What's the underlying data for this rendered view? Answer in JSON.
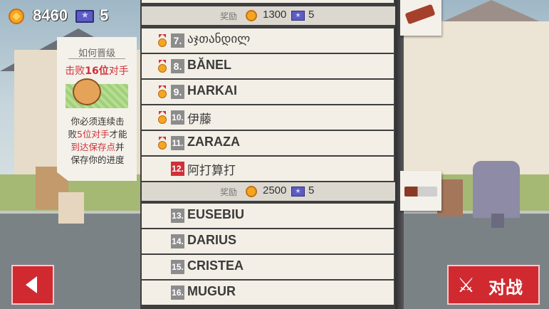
{
  "hud": {
    "coins": "8460",
    "stars": "5"
  },
  "tip": {
    "title": "如何晋级",
    "goal_pre": "击败",
    "goal_num": "16位",
    "goal_post": "对手",
    "body_1": "你必须连续击",
    "body_2a": "败",
    "body_2b": "5位对手",
    "body_2c": "才能",
    "body_3": "到达保存点",
    "body_3b": "并",
    "body_4": "保存你的进度"
  },
  "rewards": [
    {
      "label": "奖励",
      "coins": "1300",
      "stars": "5"
    },
    {
      "label": "奖励",
      "coins": "2500",
      "stars": "5"
    }
  ],
  "players": [
    {
      "rank": "7.",
      "name": "აჯთანდილ",
      "medal": true
    },
    {
      "rank": "8.",
      "name": "BĂNEL",
      "medal": true
    },
    {
      "rank": "9.",
      "name": "HARKAI",
      "medal": true
    },
    {
      "rank": "10.",
      "name": "伊藤",
      "medal": true
    },
    {
      "rank": "11.",
      "name": "ZARAZA",
      "medal": true
    },
    {
      "rank": "12.",
      "name": "阿打算打",
      "medal": false,
      "me": true
    },
    {
      "rank": "13.",
      "name": "EUSEBIU",
      "medal": false
    },
    {
      "rank": "14.",
      "name": "DARIUS",
      "medal": false
    },
    {
      "rank": "15.",
      "name": "CRISTEA",
      "medal": false
    },
    {
      "rank": "16.",
      "name": "MUGUR",
      "medal": false
    }
  ],
  "buttons": {
    "fight": "对战"
  },
  "icons": {
    "back": "back-arrow-icon",
    "fight": "crossed-swords-icon",
    "coin": "coin-icon",
    "star": "star-ticket-icon"
  },
  "colors": {
    "accent_red": "#d02a30",
    "coin": "#f4a623",
    "star": "#5c5cc4"
  }
}
